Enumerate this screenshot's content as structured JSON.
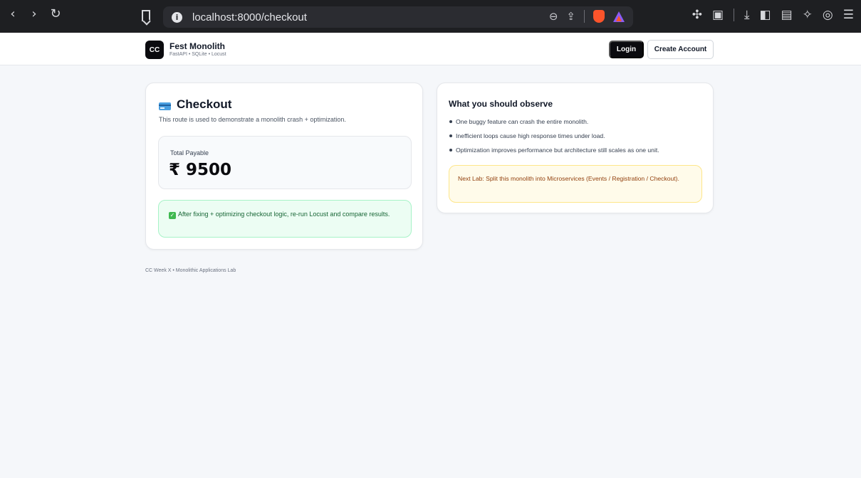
{
  "browser": {
    "url": "localhost:8000/checkout",
    "nav": {
      "back": "‹",
      "forward": "›",
      "reload": "↻"
    }
  },
  "header": {
    "logo_text": "CC",
    "brand_title": "Fest Monolith",
    "brand_subtitle": "FastAPI • SQLite • Locust",
    "login_label": "Login",
    "create_account_label": "Create Account"
  },
  "checkout": {
    "title": "Checkout",
    "description": "This route is used to demonstrate a monolith crash + optimization.",
    "total_label": "Total Payable",
    "total_value": "₹ 9500",
    "success_note": "After fixing + optimizing checkout logic, re-run Locust and compare results."
  },
  "observe": {
    "title": "What you should observe",
    "items": [
      "One buggy feature can crash the entire monolith.",
      "Inefficient loops cause high response times under load.",
      "Optimization improves performance but architecture still scales as one unit."
    ],
    "next_lab": "Next Lab: Split this monolith into Microservices (Events / Registration / Checkout)."
  },
  "footer": {
    "text": "CC Week X • Monolithic Applications Lab"
  },
  "colors": {
    "page_bg": "#f5f7fa",
    "chrome_bg": "#1e1f22",
    "primary_dark": "#0b0b0f",
    "success_bg": "#ecfdf3",
    "warning_bg": "#fffbea"
  }
}
